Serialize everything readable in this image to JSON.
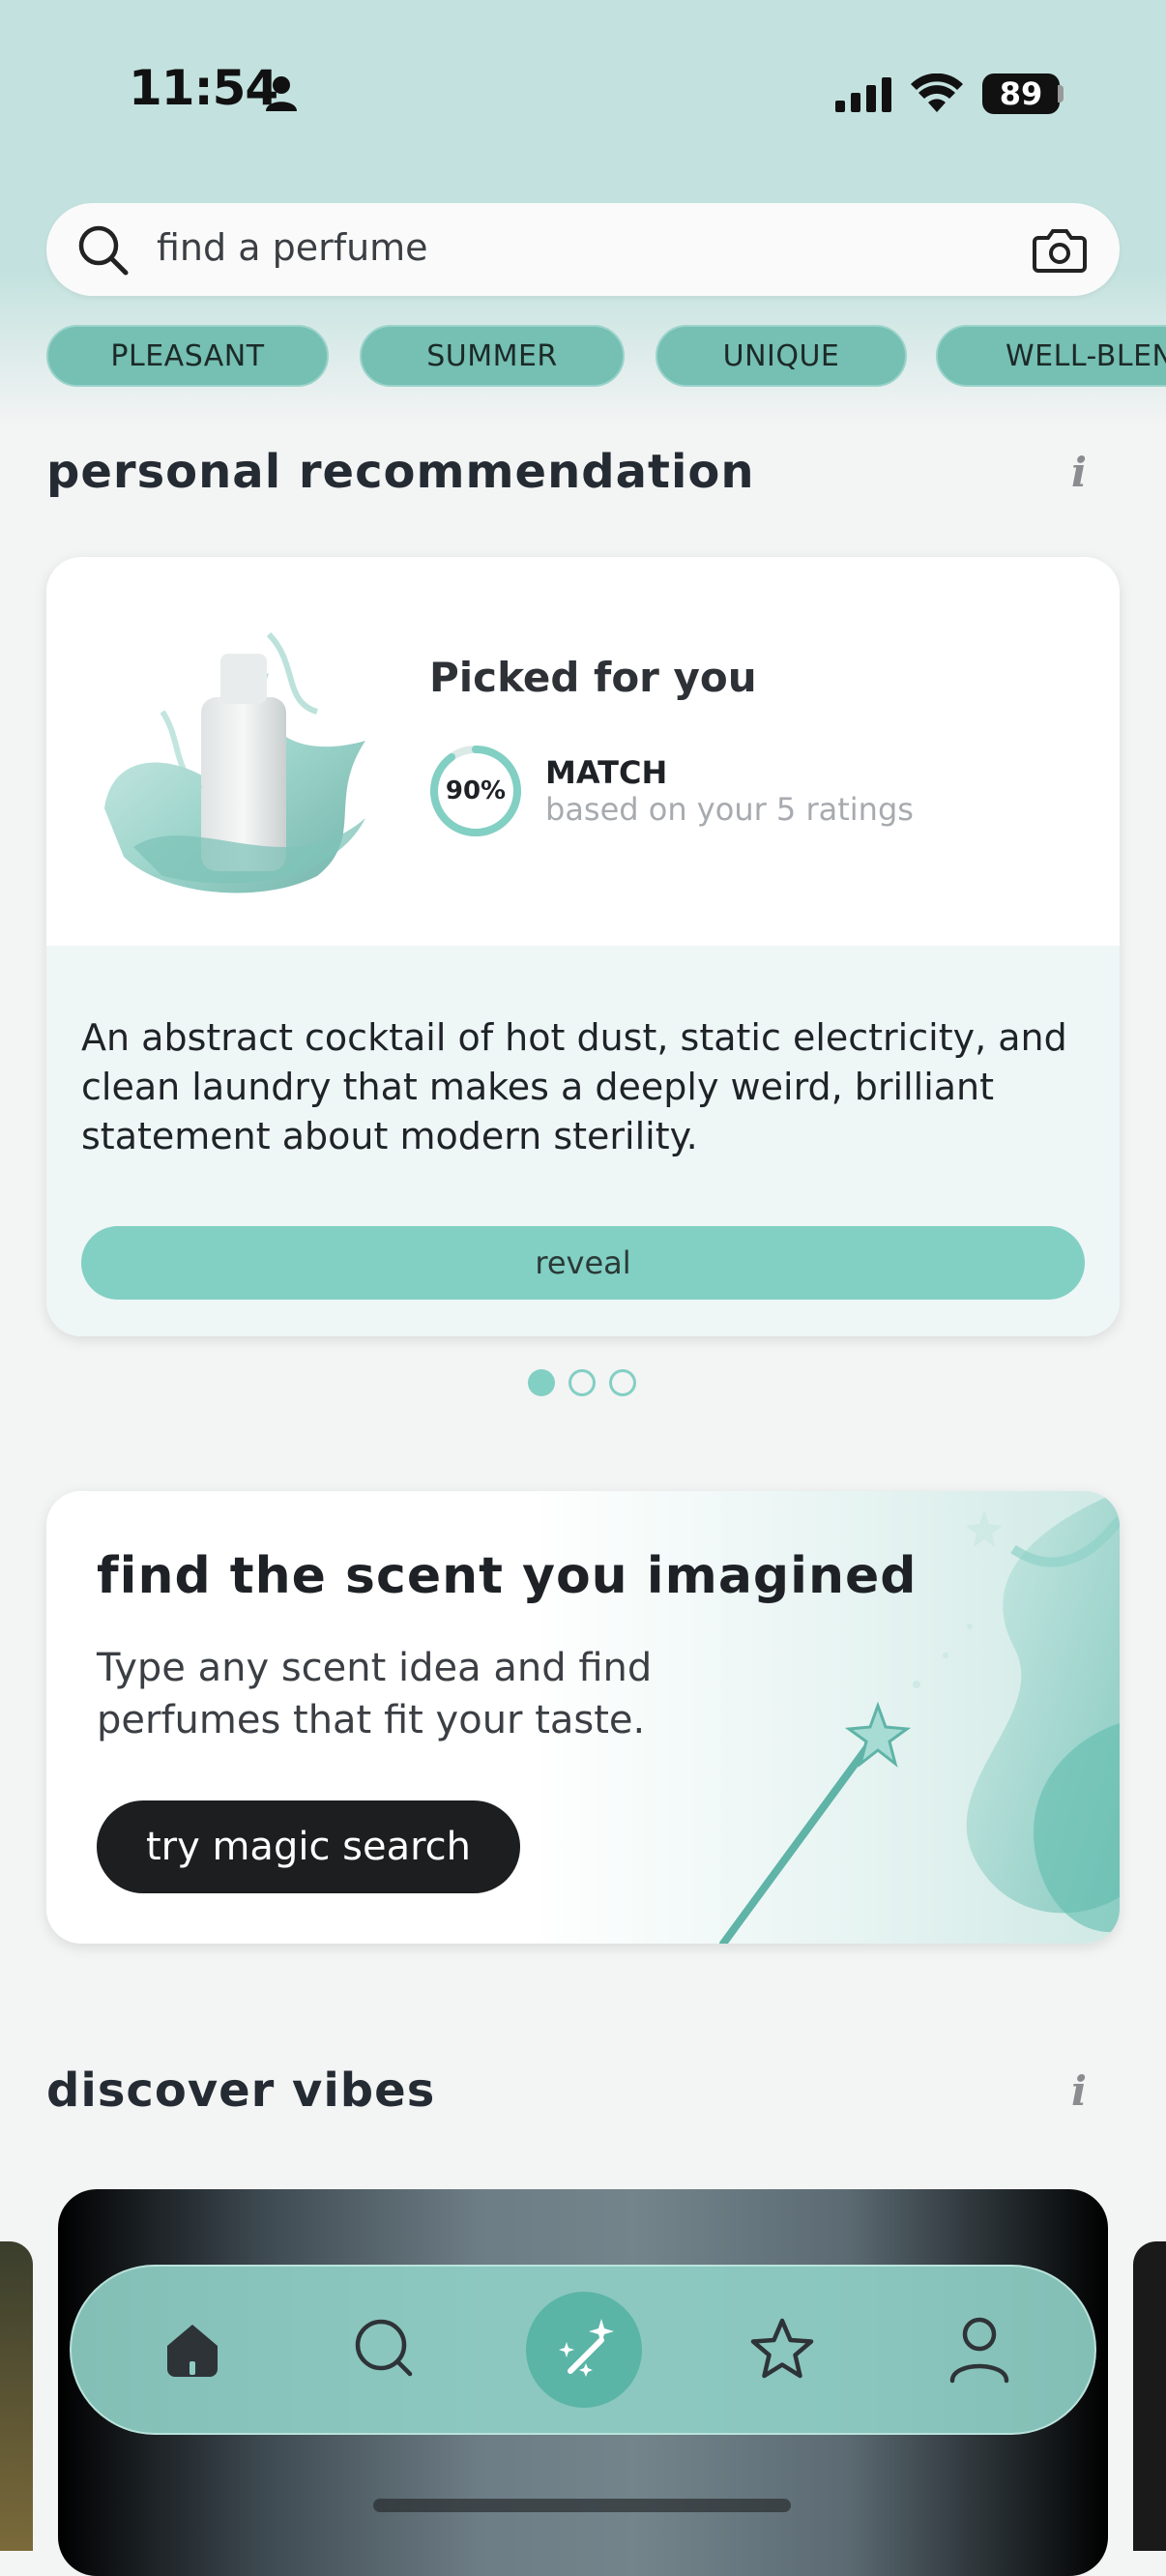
{
  "status_bar": {
    "time": "11:54",
    "battery": "89"
  },
  "search": {
    "placeholder": "find a perfume"
  },
  "chips": [
    "PLEASANT",
    "SUMMER",
    "UNIQUE",
    "WELL-BLENDED"
  ],
  "personal": {
    "section_title": "personal recommendation",
    "info": "i",
    "card": {
      "title": "Picked for you",
      "match_percent": "90%",
      "match_value": 0.9,
      "match_label": "MATCH",
      "match_sub": "based on your 5 ratings",
      "description": "An abstract cocktail of hot dust, static electricity, and clean laundry that makes a deeply weird, brilliant statement about modern sterility.",
      "button": "reveal"
    },
    "pager": {
      "count": 3,
      "active": 0
    }
  },
  "magic": {
    "title": "find the scent you imagined",
    "subtitle": "Type any scent idea and find perfumes that fit your taste.",
    "button": "try magic search"
  },
  "discover": {
    "section_title": "discover vibes",
    "info": "i"
  },
  "tabs": [
    {
      "icon": "home-icon",
      "active": true
    },
    {
      "icon": "search-icon"
    },
    {
      "icon": "magic-wand-icon",
      "highlighted": true
    },
    {
      "icon": "star-icon"
    },
    {
      "icon": "profile-icon"
    }
  ],
  "colors": {
    "accent": "#82cfc3",
    "chip": "#75bfb3",
    "header_bg": "#c3e2df",
    "tab_active": "#5bb5a7"
  }
}
